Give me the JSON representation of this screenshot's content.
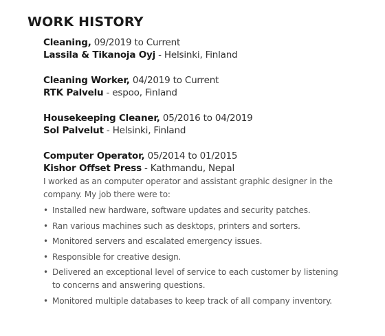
{
  "section": {
    "title": "WORK HISTORY"
  },
  "jobs": [
    {
      "title": "Cleaning,",
      "dates": " 09/2019 to Current",
      "employer": "Lassila & Tikanoja Oyj",
      "location": " - Helsinki, Finland"
    },
    {
      "title": "Cleaning Worker,",
      "dates": " 04/2019 to Current",
      "employer": "RTK Palvelu",
      "location": " - espoo, Finland"
    },
    {
      "title": "Housekeeping Cleaner,",
      "dates": " 05/2016 to 04/2019",
      "employer": "Sol Palvelut",
      "location": " - Helsinki, Finland"
    },
    {
      "title": "Computer Operator,",
      "dates": " 05/2014 to 01/2015",
      "employer": "Kishor Offset Press",
      "location": " - Kathmandu, Nepal",
      "description": "I worked as an computer operator and assistant graphic designer in the company. My job there were to:",
      "bullets": [
        "Installed new hardware, software updates and security patches.",
        "Ran various machines such as desktops, printers and sorters.",
        "Monitored servers and escalated emergency issues.",
        "Responsible for creative design.",
        "Delivered an exceptional level of service to each customer by listening to concerns and answering questions.",
        "Monitored multiple databases to keep track of all company inventory."
      ]
    }
  ]
}
